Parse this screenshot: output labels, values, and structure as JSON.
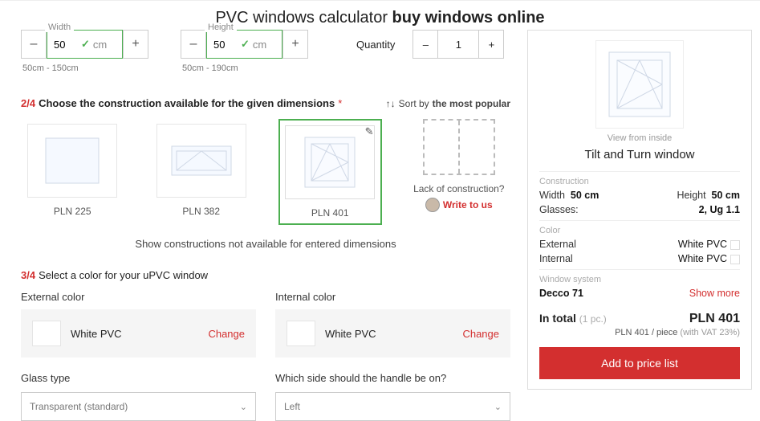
{
  "title": {
    "a": "PVC windows calculator ",
    "b": "buy windows online"
  },
  "dim": {
    "width": {
      "label": "Width",
      "value": "50",
      "unit": "cm",
      "hint": "50cm - 150cm"
    },
    "height": {
      "label": "Height",
      "value": "50",
      "unit": "cm",
      "hint": "50cm - 190cm"
    },
    "minus": "–",
    "plus": "+"
  },
  "qty": {
    "label": "Quantity",
    "value": "1",
    "minus": "–",
    "plus": "+"
  },
  "step2": {
    "num": "2/4",
    "title": "Choose the construction available for the given dimensions",
    "star": "*",
    "sort_label": "Sort by",
    "sort_value": "the most popular"
  },
  "constructions": {
    "a": "PLN 225",
    "b": "PLN 382",
    "c": "PLN 401"
  },
  "lack": {
    "q": "Lack of construction?",
    "write": "Write to us"
  },
  "show_more": "Show constructions not available for entered dimensions",
  "step3": {
    "num": "3/4",
    "title": " Select a color for your uPVC window"
  },
  "colors": {
    "ext_label": "External color",
    "int_label": "Internal color",
    "ext_value": "White PVC",
    "int_value": "White PVC",
    "change": "Change"
  },
  "glass": {
    "label": "Glass type",
    "value": "Transparent (standard)"
  },
  "handle": {
    "label": "Which side should the handle be on?",
    "value": "Left"
  },
  "summary": {
    "view": "View from inside",
    "title": "Tilt and Turn window",
    "sec_construction": "Construction",
    "width_k": "Width",
    "width_v": "50 cm",
    "height_k": "Height",
    "height_v": "50 cm",
    "glasses_k": "Glasses:",
    "glasses_v": "2, Ug 1.1",
    "sec_color": "Color",
    "ext_k": "External",
    "ext_v": "White PVC",
    "int_k": "Internal",
    "int_v": "White PVC",
    "sec_system": "Window system",
    "system_v": "Decco 71",
    "show_more": "Show more",
    "total_k": "In total",
    "total_pc": "(1 pc.)",
    "total_v": "PLN 401",
    "note_pp": "PLN 401 / piece",
    "note_vat": " (with VAT 23%)",
    "add": "Add to price list"
  }
}
